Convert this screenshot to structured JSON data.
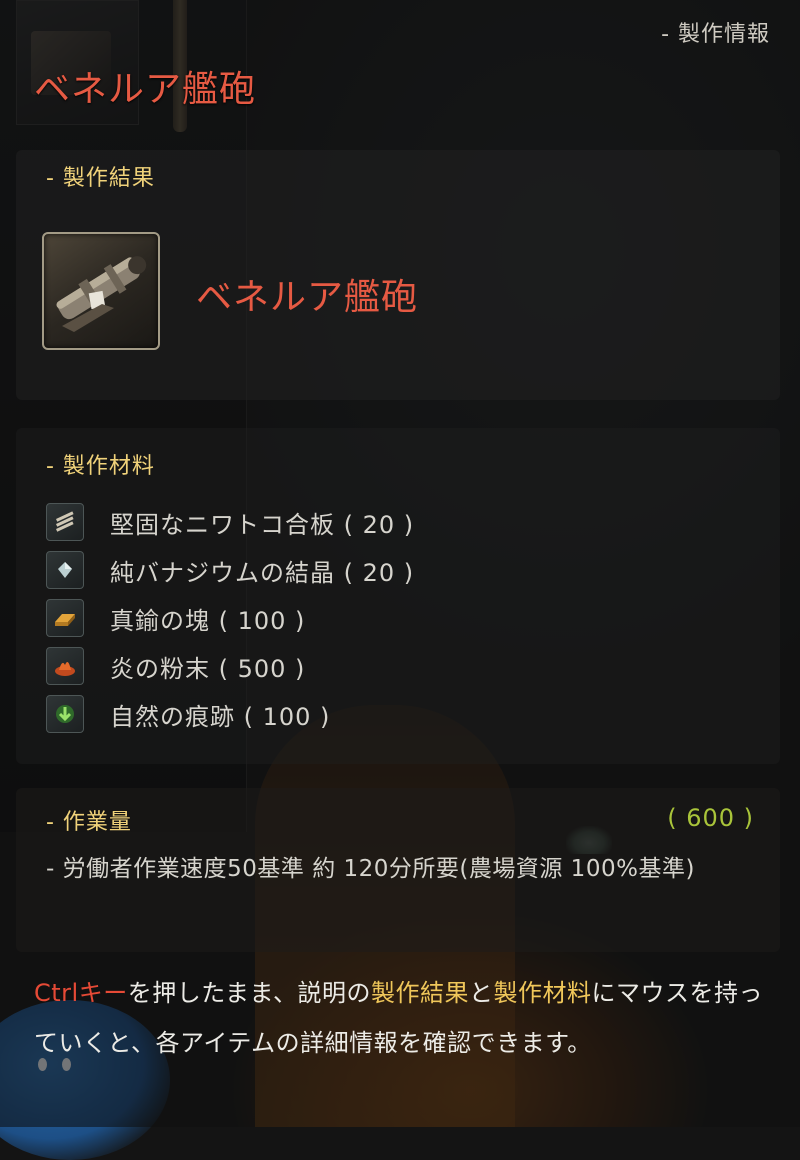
{
  "header": {
    "label": "- 製作情報"
  },
  "title": "ベネルア艦砲",
  "result": {
    "label": "- 製作結果",
    "item_name": "ベネルア艦砲",
    "icon": "cannon-icon"
  },
  "materials": {
    "label": "- 製作材料",
    "items": [
      {
        "name": "堅固なニワトコ合板 ( 20 )",
        "icon": "plywood-icon"
      },
      {
        "name": "純バナジウムの結晶 ( 20 )",
        "icon": "crystal-icon"
      },
      {
        "name": "真鍮の塊 ( 100 )",
        "icon": "brass-ingot-icon"
      },
      {
        "name": "炎の粉末 ( 500 )",
        "icon": "fire-powder-icon"
      },
      {
        "name": "自然の痕跡 ( 100 )",
        "icon": "nature-trace-icon"
      }
    ]
  },
  "workload": {
    "label": "- 作業量",
    "value": "( 600 )",
    "description": "- 労働者作業速度50基準 約 120分所要(農場資源 100%基準)"
  },
  "hint": {
    "ctrl_key": "Ctrlキー",
    "part1": "を押したまま、説明の",
    "result_word": "製作結果",
    "part2": "と",
    "materials_word": "製作材料",
    "part3": "にマウスを持っていくと、各アイテムの詳細情報を確認できます。"
  },
  "colors": {
    "title_red": "#e65a43",
    "section_gold": "#f0d27a",
    "workload_green": "#a9c43a",
    "hint_red": "#e64a36",
    "hint_gold": "#f0c75a"
  }
}
